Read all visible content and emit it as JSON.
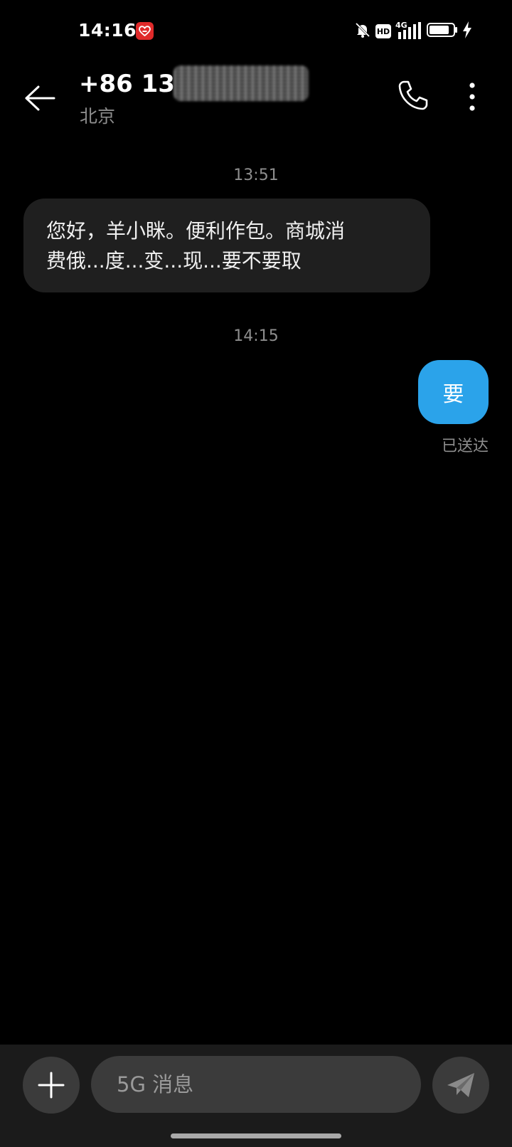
{
  "status_bar": {
    "time": "14:16",
    "app_icon": "heart-app-icon",
    "icons": [
      "mute-bell-icon",
      "hd-icon",
      "4g-signal-icon",
      "battery-icon",
      "charging-icon"
    ],
    "hd_label": "HD",
    "network_label": "4G"
  },
  "header": {
    "contact_number": "+86 136",
    "location": "北京",
    "back_icon": "back-arrow-icon",
    "call_icon": "phone-icon",
    "more_icon": "more-vertical-icon"
  },
  "conversation": {
    "messages": [
      {
        "timestamp": "13:51",
        "direction": "incoming",
        "lines": [
          "您好，羊小眯。便利作包。商城消",
          "费俄...度...变...现...要不要取"
        ]
      },
      {
        "timestamp": "14:15",
        "direction": "outgoing",
        "text": "要",
        "status": "已送达"
      }
    ]
  },
  "composer": {
    "placeholder": "5G 消息",
    "add_icon": "plus-icon",
    "send_icon": "send-plane-icon"
  },
  "colors": {
    "background": "#000000",
    "incoming_bubble": "#1f1f1f",
    "outgoing_bubble": "#2ba3ea",
    "muted_text": "#8e8e8e",
    "composer_bg": "#1b1b1b"
  }
}
